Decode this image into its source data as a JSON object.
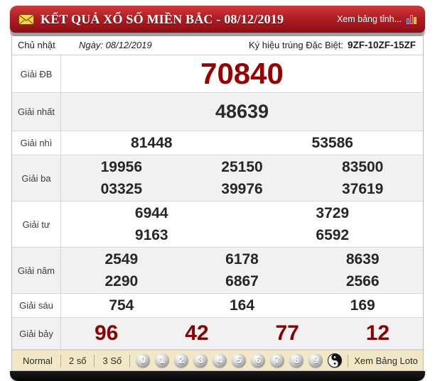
{
  "header": {
    "title": "KẾT QUẢ XỔ SỐ MIỀN BẮC - 08/12/2019",
    "province_link": "Xem bảng tỉnh..."
  },
  "info": {
    "day": "Chủ nhật",
    "date_label": "Ngày: 08/12/2019",
    "symbol_label": "Ký hiệu trúng Đặc Biệt:",
    "symbol_value": "9ZF-10ZF-15ZF"
  },
  "results": [
    {
      "label": "Giải ĐB",
      "style": "special",
      "rows": [
        [
          "70840"
        ]
      ]
    },
    {
      "label": "Giải nhất",
      "style": "first",
      "rows": [
        [
          "48639"
        ]
      ]
    },
    {
      "label": "Giải nhì",
      "style": "normal",
      "rows": [
        [
          "81448",
          "53586"
        ]
      ]
    },
    {
      "label": "Giải ba",
      "style": "normal",
      "rows": [
        [
          "19956",
          "25150",
          "83500"
        ],
        [
          "03325",
          "39976",
          "37619"
        ]
      ]
    },
    {
      "label": "Giải tư",
      "style": "normal",
      "rows": [
        [
          "6944",
          "3729"
        ],
        [
          "9163",
          "6592"
        ]
      ]
    },
    {
      "label": "Giải năm",
      "style": "normal",
      "rows": [
        [
          "2549",
          "6178",
          "8639"
        ],
        [
          "2290",
          "6867",
          "2566"
        ]
      ]
    },
    {
      "label": "Giải sáu",
      "style": "normal",
      "rows": [
        [
          "754",
          "164",
          "169"
        ]
      ]
    },
    {
      "label": "Giải bảy",
      "style": "seventh",
      "rows": [
        [
          "96",
          "42",
          "77",
          "12"
        ]
      ]
    }
  ],
  "toolbar": {
    "modes": [
      "Normal",
      "2 số",
      "3 Số"
    ],
    "digits": [
      "0",
      "1",
      "2",
      "3",
      "4",
      "5",
      "6",
      "7",
      "8",
      "9"
    ],
    "yinyang_icon": "yin-yang-icon",
    "loto_link": "Xem Bảng Loto"
  },
  "icons": {
    "envelope": "envelope-icon",
    "bar_chart": "bar-chart-icon"
  },
  "colors": {
    "header_red": "#b01e24",
    "special_number": "#990000",
    "seventh_number": "#8b0000",
    "toolbar_bg": "#f3e8c5",
    "row_alt_bg": "#f1f1f1"
  }
}
